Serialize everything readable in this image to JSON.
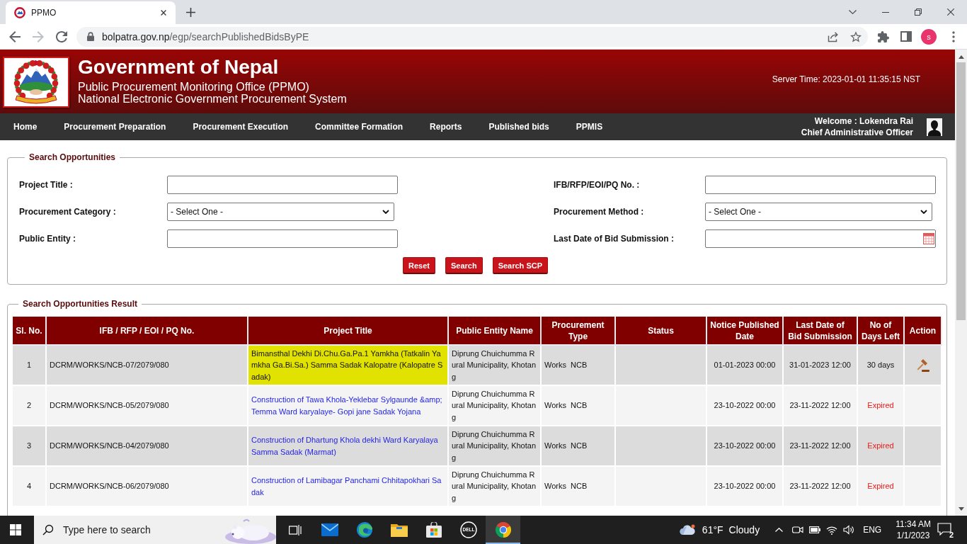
{
  "browser": {
    "tabs": [
      {
        "title": "PPMO",
        "selected": true
      }
    ],
    "address": {
      "host": "bolpatra.gov.np",
      "path": "/egp/searchPublishedBidsByPE"
    },
    "profile_initial": "s"
  },
  "header": {
    "title": "Government of Nepal",
    "subtitles": [
      "Public Procurement Monitoring Office (PPMO)",
      "National Electronic Government Procurement System"
    ],
    "server_time": "Server Time: 2023-01-01 11:35:15 NST"
  },
  "nav": {
    "items": [
      "Home",
      "Procurement Preparation",
      "Procurement Execution",
      "Committee Formation",
      "Reports",
      "Published bids",
      "PPMIS"
    ],
    "welcome": "Welcome : Lokendra Rai",
    "role": "Chief Administrative Officer"
  },
  "search": {
    "legend": "Search Opportunities",
    "fields": [
      {
        "label": "Project Title :",
        "kind": "text"
      },
      {
        "label": "IFB/RFP/EOI/PQ No. :",
        "kind": "text"
      },
      {
        "label": "Procurement Category :",
        "kind": "select",
        "value": "- Select One -"
      },
      {
        "label": "Procurement Method :",
        "kind": "select",
        "value": "- Select One -"
      },
      {
        "label": "Public Entity :",
        "kind": "text"
      },
      {
        "label": "Last Date of Bid Submission :",
        "kind": "date"
      }
    ],
    "buttons": [
      "Reset",
      "Search",
      "Search SCP"
    ]
  },
  "results": {
    "legend": "Search Opportunities Result",
    "columns": [
      "Sl. No.",
      "IFB / RFP / EOI / PQ No.",
      "Project Title",
      "Public Entity Name",
      "Procurement Type",
      "Status",
      "Notice Published Date",
      "Last Date of\nBid Submission",
      "No of Days Left",
      "Action"
    ],
    "rows": [
      {
        "sl": "1",
        "ifb": "DCRM/WORKS/NCB-07/2079/080",
        "title": "Bimansthal Dekhi Di.Chu.Ga.Pa.1 Yamkha (Tatkalin Yamkha Ga.Bi.Sa.) Samma Sadak Kalopatre (Kalopatre Sadak)",
        "highlighted": true,
        "entity": "Diprung Chuichumma Rural Municipality, Khotang",
        "type": "Works  NCB",
        "published": "01-01-2023 00:00",
        "deadline": "31-01-2023 12:00",
        "days_left": "30 days",
        "expired": false,
        "bid_action": true
      },
      {
        "sl": "2",
        "ifb": "DCRM/WORKS/NCB-05/2079/080",
        "title": "Construction of Tawa Khola-Yeklebar Sylgaunde &amp; Temma Ward karyalaye- Gopi jane Sadak Yojana",
        "highlighted": false,
        "entity": "Diprung Chuichumma Rural Municipality, Khotang",
        "type": "Works  NCB",
        "published": "23-10-2022 00:00",
        "deadline": "23-11-2022 12:00",
        "days_left": "Expired",
        "expired": true,
        "bid_action": false
      },
      {
        "sl": "3",
        "ifb": "DCRM/WORKS/NCB-04/2079/080",
        "title": "Construction of Dhartung Khola dekhi Ward Karyalaya Samma Sadak (Marmat)",
        "highlighted": false,
        "entity": "Diprung Chuichumma Rural Municipality, Khotang",
        "type": "Works  NCB",
        "published": "23-10-2022 00:00",
        "deadline": "23-11-2022 12:00",
        "days_left": "Expired",
        "expired": true,
        "bid_action": false
      },
      {
        "sl": "4",
        "ifb": "DCRM/WORKS/NCB-06/2079/080",
        "title": "Construction of Lamibagar Panchami Chhitapokhari Sadak",
        "highlighted": false,
        "entity": "Diprung Chuichumma Rural Municipality, Khotang",
        "type": "Works  NCB",
        "published": "23-10-2022 00:00",
        "deadline": "23-11-2022 12:00",
        "days_left": "Expired",
        "expired": true,
        "bid_action": false
      }
    ]
  },
  "taskbar": {
    "search_placeholder": "Type here to search",
    "apps": [
      {
        "kind": "task-view",
        "active": false
      },
      {
        "kind": "mail",
        "active": false
      },
      {
        "kind": "edge",
        "active": false
      },
      {
        "kind": "explorer",
        "active": false
      },
      {
        "kind": "store",
        "active": false
      },
      {
        "kind": "dell",
        "label": "DELL",
        "active": false
      },
      {
        "kind": "chrome",
        "active": true
      }
    ],
    "weather": {
      "temperature": "61°F",
      "condition": "Cloudy"
    },
    "language": "ENG",
    "time": "11:34 AM",
    "date": "1/1/2023",
    "notifications": "2"
  }
}
